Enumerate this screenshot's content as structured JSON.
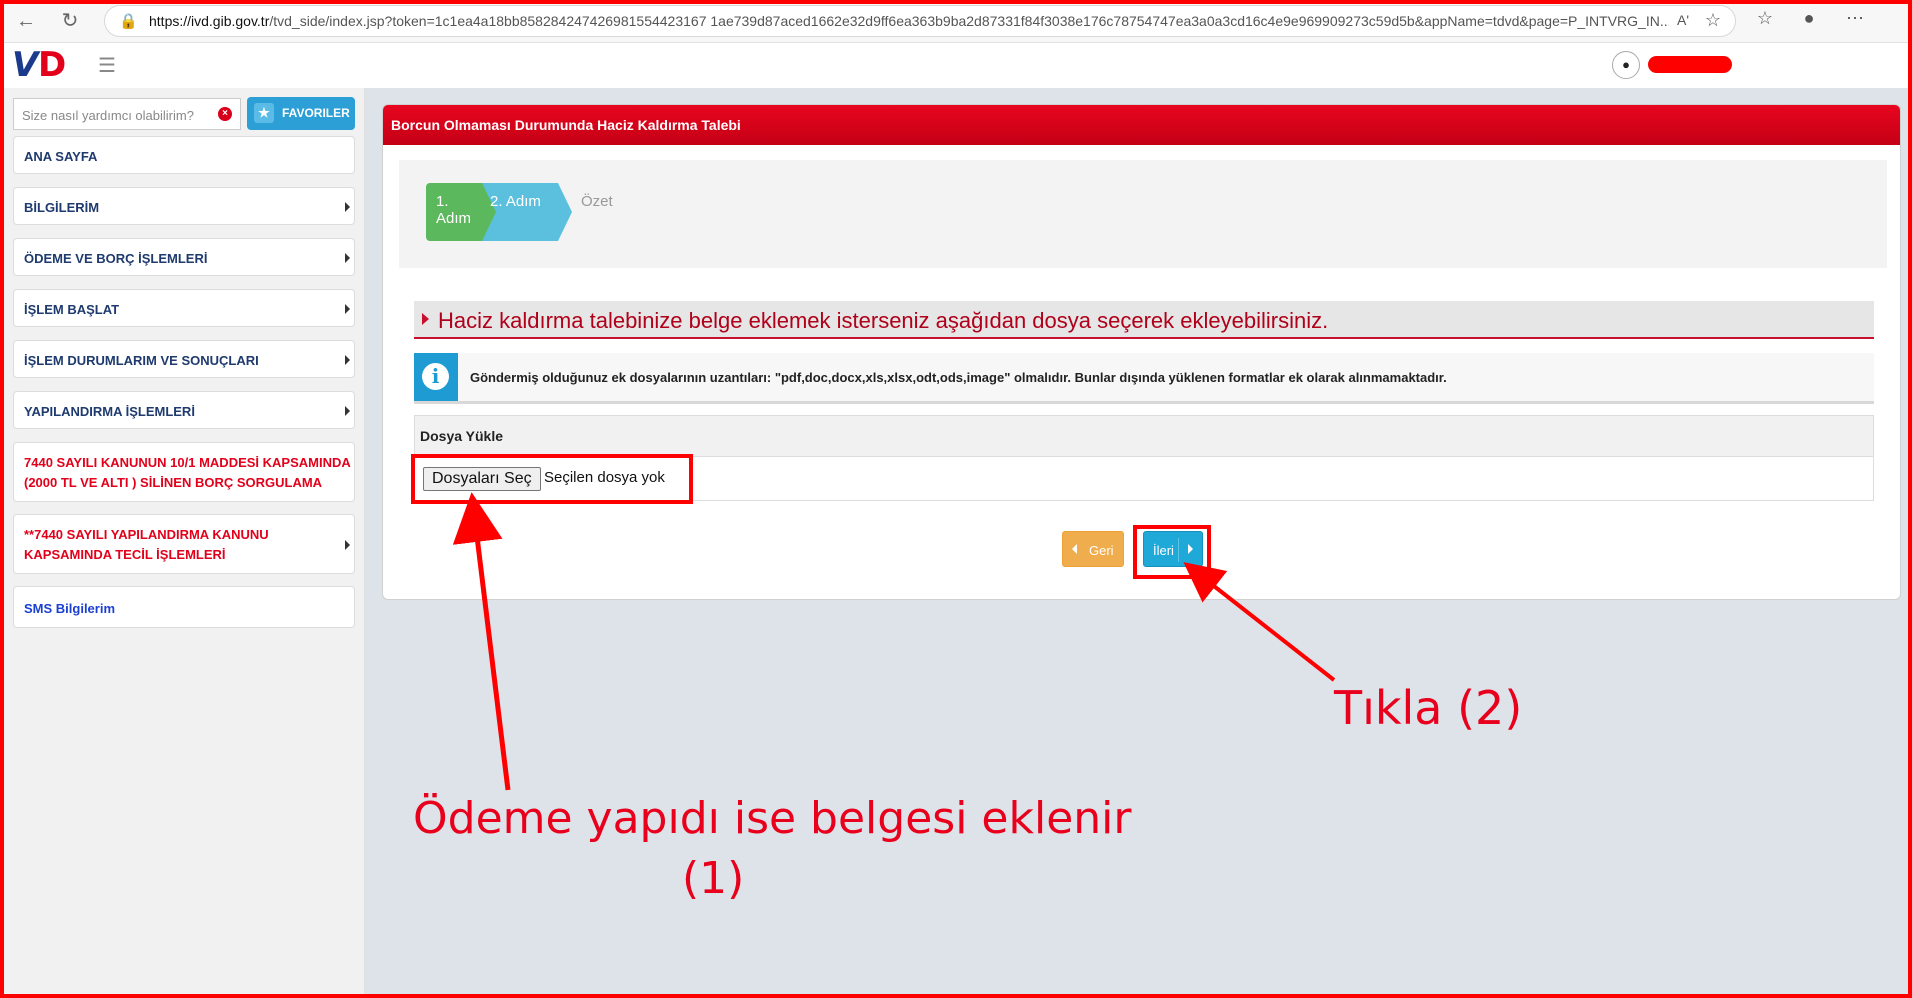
{
  "browser": {
    "url_domain": "https://ivd.gib.gov.tr",
    "url_path": "/tvd_side/index.jsp?token=1c1ea4a18bb858284247426981554423167 1ae739d87aced1662e32d9ff6ea363b9ba2d87331f84f3038e176c78754747ea3a0a3cd16c4e9e969909273c59d5b&appName=tdvd&page=P_INTVRG_IN...",
    "reader_label": "Aʹ"
  },
  "app": {
    "logo_v": "V",
    "logo_d": "D"
  },
  "sidebar": {
    "search_placeholder": "Size nasıl yardımcı olabilirim?",
    "favorites_label": "FAVORILER",
    "items": [
      {
        "label": "ANA SAYFA"
      },
      {
        "label": "BİLGİLERİM"
      },
      {
        "label": "ÖDEME VE BORÇ İŞLEMLERİ"
      },
      {
        "label": "İŞLEM BAŞLAT"
      },
      {
        "label": "İŞLEM DURUMLARIM VE SONUÇLARI"
      },
      {
        "label": "YAPILANDIRMA İŞLEMLERİ"
      },
      {
        "label_line1": "7440 SAYILI KANUNUN 10/1 MADDESİ KAPSAMINDA",
        "label_line2": "(2000 TL VE ALTI ) SİLİNEN BORÇ SORGULAMA"
      },
      {
        "label_line1": "**7440 SAYILI YAPILANDIRMA KANUNU",
        "label_line2": "KAPSAMINDA TECİL İŞLEMLERİ"
      },
      {
        "label": "SMS Bilgilerim"
      }
    ]
  },
  "panel": {
    "title": "Borcun Olmaması Durumunda Haciz Kaldırma Talebi",
    "steps": [
      "1. Adım",
      "2. Adım",
      "Özet"
    ],
    "section_title": "Haciz kaldırma talebinize belge eklemek isterseniz aşağıdan dosya seçerek ekleyebilirsiniz.",
    "info_text": "Göndermiş olduğunuz ek dosyalarının uzantıları: \"pdf,doc,docx,xls,xlsx,odt,ods,image\" olmalıdır. Bunlar dışında yüklenen formatlar ek olarak alınmamaktadır.",
    "upload_header": "Dosya Yükle",
    "file_button": "Dosyaları Seç",
    "file_status": "Seçilen dosya yok",
    "back_label": "Geri",
    "next_label": "İleri"
  },
  "annotations": {
    "click_label": "Tıkla (2)",
    "upload_label_line1": "Ödeme yapıdı ise belgesi eklenir",
    "upload_label_line2": "(1)"
  },
  "colors": {
    "header_red": "#e3001b",
    "annotation_red": "#ff0000",
    "step1_green": "#5cb85c",
    "step2_blue": "#5bc0de",
    "next_button": "#1ea9d8",
    "back_button": "#f0ad4e"
  }
}
